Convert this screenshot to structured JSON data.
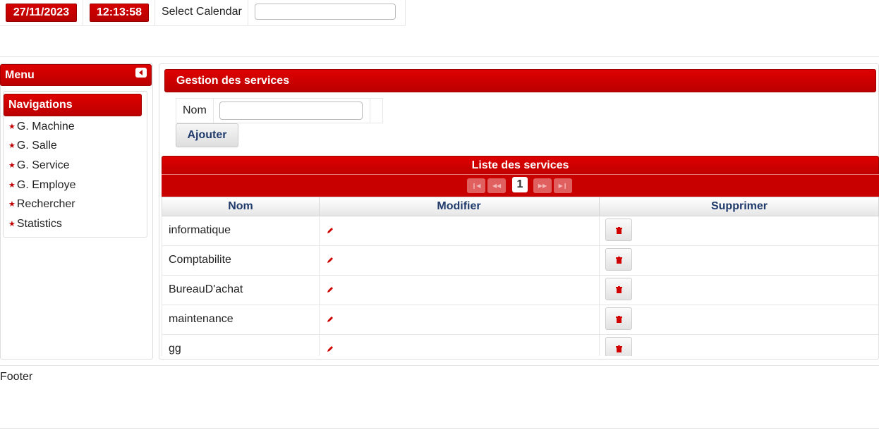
{
  "header": {
    "date": "27/11/2023",
    "time": "12:13:58",
    "select_calendar_label": "Select Calendar",
    "calendar_value": ""
  },
  "menu": {
    "title": "Menu",
    "navigation_title": "Navigations",
    "items": [
      {
        "label": "G. Machine",
        "icon": "star-icon"
      },
      {
        "label": "G. Salle",
        "icon": "star-icon"
      },
      {
        "label": "G. Service",
        "icon": "star-icon"
      },
      {
        "label": "G. Employe",
        "icon": "star-icon"
      },
      {
        "label": "Rechercher",
        "icon": "star-icon"
      },
      {
        "label": "Statistics",
        "icon": "star-icon"
      }
    ]
  },
  "gestion": {
    "title": "Gestion des services",
    "nom_label": "Nom",
    "nom_value": "",
    "add_button": "Ajouter"
  },
  "table": {
    "title": "Liste des services",
    "current_page": "1",
    "columns": [
      "Nom",
      "Modifier",
      "Supprimer"
    ],
    "rows": [
      {
        "nom": "informatique"
      },
      {
        "nom": "Comptabilite"
      },
      {
        "nom": "BureauD'achat"
      },
      {
        "nom": "maintenance"
      },
      {
        "nom": "gg"
      }
    ],
    "edit_icon": "pencil-icon",
    "delete_icon": "trash-icon"
  },
  "footer": {
    "text": "Footer"
  },
  "colors": {
    "brand_red": "#c00000",
    "header_text_blue": "#1f3a6b"
  }
}
